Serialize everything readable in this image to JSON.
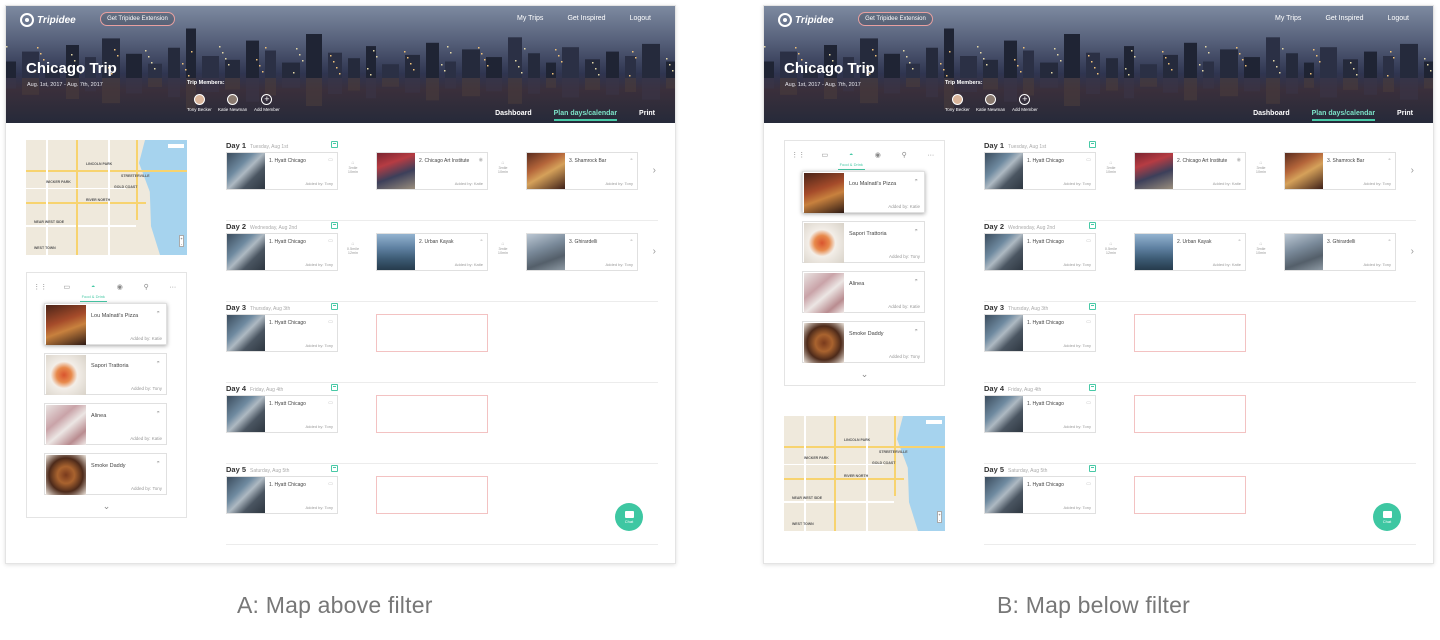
{
  "header": {
    "brand": "Tripidee",
    "extension_button": "Get Tripidee Extension",
    "nav": [
      "My Trips",
      "Get Inspired",
      "Logout"
    ],
    "trip_title": "Chicago Trip",
    "trip_dates": "Aug. 1st, 2017 - Aug. 7th, 2017",
    "members_label": "Trip Members:",
    "members": [
      "Tony Becker",
      "Katie Newman"
    ],
    "add_member": "Add Member",
    "tabs": [
      "Dashboard",
      "Plan days/calendar",
      "Print"
    ],
    "active_tab": "Plan days/calendar"
  },
  "map": {
    "labels": [
      "LINCOLN PARK",
      "RIVER NORTH",
      "GOLD COAST",
      "WEST TOWN",
      "NEAR WEST SIDE",
      "STREETERVILLE",
      "WICKER PARK"
    ]
  },
  "filter": {
    "icons": [
      "grid-icon",
      "bed-icon",
      "food-icon",
      "eye-icon",
      "bike-icon",
      "more-icon"
    ],
    "active_label": "Food & Drink",
    "items": [
      {
        "name": "Lou Malnati's Pizza",
        "added": "Added by: Katie"
      },
      {
        "name": "Sapori Trattoria",
        "added": "Added by: Tony"
      },
      {
        "name": "Alinea",
        "added": "Added by: Katie"
      },
      {
        "name": "Smoke Daddy",
        "added": "Added by: Tony"
      }
    ]
  },
  "days": [
    {
      "label": "Day 1",
      "date": "Tuesday, Aug 1st",
      "places": [
        {
          "name": "1. Hyatt Chicago",
          "added": "Added by: Tony"
        },
        {
          "name": "2. Chicago Art Institute",
          "added": "Added by: Katie"
        },
        {
          "name": "3. Shamrock Bar",
          "added": "Added by: Tony"
        }
      ],
      "travel": [
        [
          "3mile",
          "10min"
        ],
        [
          "3mile",
          "10min"
        ]
      ]
    },
    {
      "label": "Day 2",
      "date": "Wednesday, Aug 2nd",
      "places": [
        {
          "name": "1. Hyatt Chicago",
          "added": "Added by: Tony"
        },
        {
          "name": "2. Urban Kayak",
          "added": "Added by: Katie"
        },
        {
          "name": "3. Ghirardelli",
          "added": "Added by: Tony"
        }
      ],
      "travel": [
        [
          "0.5mile",
          "12min"
        ],
        [
          "3mile",
          "10min"
        ]
      ]
    },
    {
      "label": "Day 3",
      "date": "Thursday, Aug 3th",
      "places": [
        {
          "name": "1. Hyatt Chicago",
          "added": "Added by: Tony"
        }
      ]
    },
    {
      "label": "Day 4",
      "date": "Friday, Aug 4th",
      "places": [
        {
          "name": "1. Hyatt Chicago",
          "added": "Added by: Tony"
        }
      ]
    },
    {
      "label": "Day 5",
      "date": "Saturday, Aug 5th",
      "places": [
        {
          "name": "1. Hyatt Chicago",
          "added": "Added by: Tony"
        }
      ]
    }
  ],
  "chat_label": "Chat",
  "captions": {
    "a": "A: Map above filter",
    "b": "B: Map below filter"
  },
  "colors": {
    "accent": "#48c9a6",
    "chat": "#3ec7a2",
    "empty_slot_border": "#f3c2c2"
  }
}
